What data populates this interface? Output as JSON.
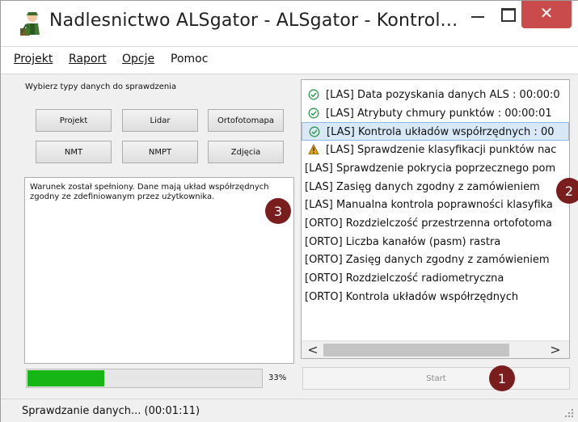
{
  "window": {
    "title": "Nadlesnictwo ALSgator - ALSgator - Kontrol...",
    "close_glyph": "✕",
    "icon": "forester-app-icon"
  },
  "menu": [
    {
      "label": "Projekt"
    },
    {
      "label": "Raport"
    },
    {
      "label": "Opcje"
    },
    {
      "label": "Pomoc"
    }
  ],
  "left_panel": {
    "group_label": "Wybierz typy danych do sprawdzenia",
    "buttons": [
      "Projekt",
      "Lidar",
      "Ortofotomapa",
      "NMT",
      "NMPT",
      "Zdjęcia"
    ],
    "message": "Warunek został spełniony. Dane mają układ współrzędnych zgodny ze zdefiniowanym przez użytkownika."
  },
  "checks": {
    "items": [
      {
        "text": "[LAS] Data pozyskania danych ALS : 00:00:0",
        "status": "ok"
      },
      {
        "text": "[LAS] Atrybuty chmury punktów : 00:00:01",
        "status": "ok"
      },
      {
        "text": "[LAS] Kontrola układów współrzędnych : 00",
        "status": "ok",
        "selected": true
      },
      {
        "text": "[LAS] Sprawdzenie klasyfikacji punktów nac",
        "status": "warning"
      },
      {
        "text": "[LAS] Sprawdzenie pokrycia poprzecznego pom",
        "status": "none"
      },
      {
        "text": "[LAS] Zasięg danych zgodny z zamówieniem",
        "status": "none"
      },
      {
        "text": "[LAS] Manualna kontrola poprawności klasyfika",
        "status": "none"
      },
      {
        "text": "[ORTO] Rozdzielczość przestrzenna ortofotoma",
        "status": "none"
      },
      {
        "text": "[ORTO] Liczba kanałów (pasm) rastra",
        "status": "none"
      },
      {
        "text": "[ORTO] Zasięg danych zgodny z zamówieniem",
        "status": "none"
      },
      {
        "text": "[ORTO] Rozdzielczość radiometryczna",
        "status": "none"
      },
      {
        "text": "[ORTO] Kontrola układów współrzędnych",
        "status": "none"
      }
    ],
    "scroll_left": "<",
    "scroll_right": ">"
  },
  "progress": {
    "value": 0.33,
    "label": "33%"
  },
  "start_label": "Start",
  "badges": [
    "1",
    "2",
    "3"
  ],
  "status_text": "Sprawdzanie danych... (00:01:11)",
  "colors": {
    "close": "#c94b4b",
    "progress": "#15b615",
    "badge": "#7a1d1d",
    "ok_icon": "#2e9a4e",
    "warning_icon": "#e8a400",
    "selection": "#d8e8f7"
  }
}
